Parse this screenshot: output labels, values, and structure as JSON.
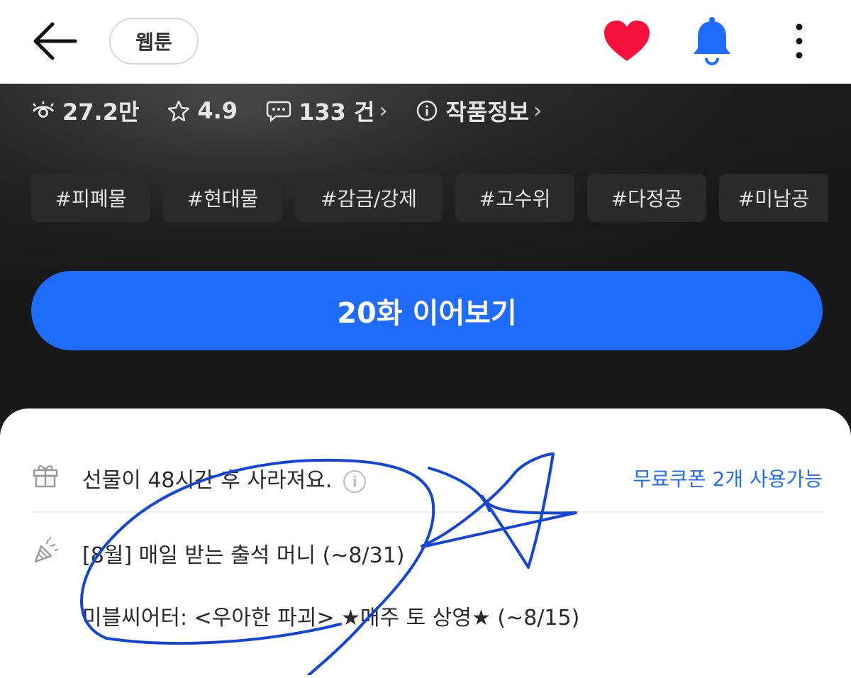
{
  "header": {
    "category_label": "웹툰",
    "icons": [
      "back-arrow-icon",
      "heart-icon",
      "bell-icon",
      "more-vertical-icon"
    ]
  },
  "stats": {
    "views": "27.2만",
    "rating": "4.9",
    "comments": "133 건",
    "info": "작품정보"
  },
  "tags": [
    "#피폐물",
    "#현대물",
    "#감금/강제",
    "#고수위",
    "#다정공",
    "#미남공"
  ],
  "cta": {
    "label": "20화 이어보기"
  },
  "notices": {
    "gift_text": "선물이 48시간 후 사라져요.",
    "coupon_text": "무료쿠폰 2개 사용가능",
    "event_1": "[8월] 매일 받는 출석 머니 (~8/31)",
    "event_2": "미블씨어터: <우아한 파괴> ★매주 토 상영★ (~8/15)"
  },
  "colors": {
    "accent_blue": "#1f6bfc",
    "heart_red": "#f5103d",
    "annotation_blue": "#1245d8"
  }
}
